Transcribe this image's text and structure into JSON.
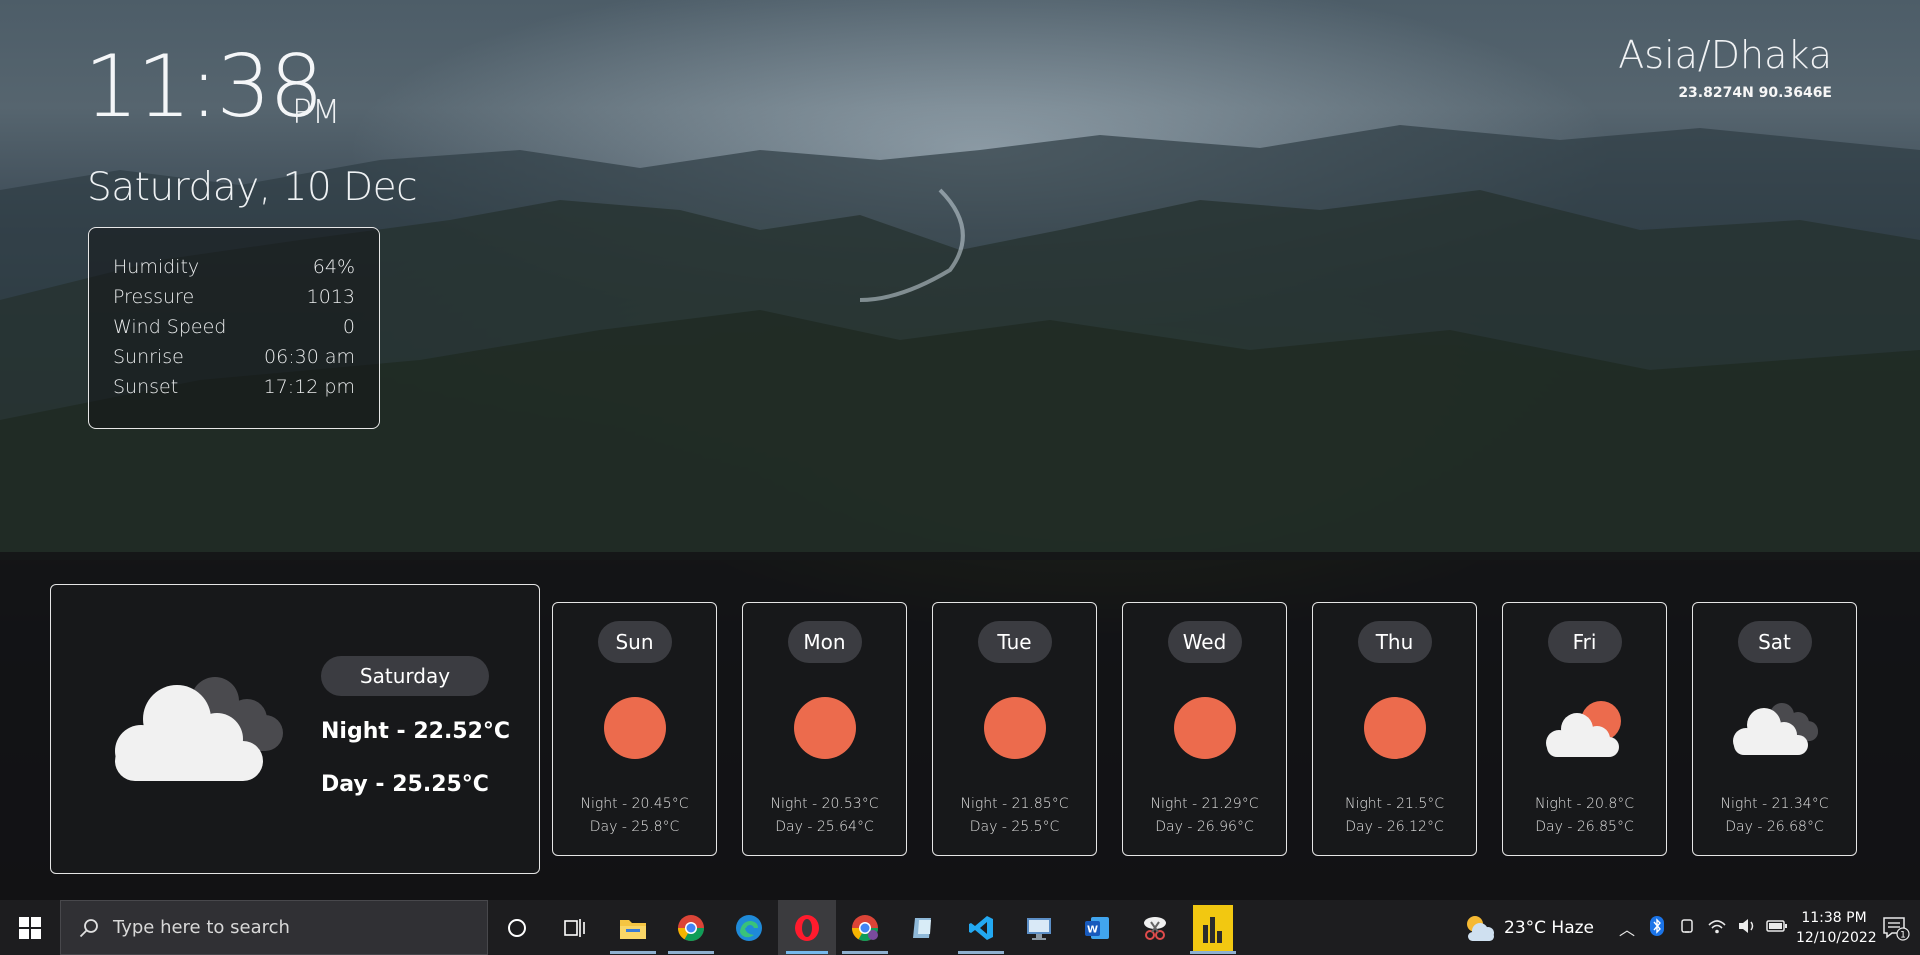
{
  "clock": {
    "time": "11:38",
    "ampm": "PM",
    "date": "Saturday, 10 Dec"
  },
  "location": {
    "timezone": "Asia/Dhaka",
    "coords": "23.8274N 90.3646E"
  },
  "details": [
    {
      "label": "Humidity",
      "value": "64%"
    },
    {
      "label": "Pressure",
      "value": "1013"
    },
    {
      "label": "Wind Speed",
      "value": "0"
    },
    {
      "label": "Sunrise",
      "value": "06:30 am"
    },
    {
      "label": "Sunset",
      "value": "17:12 pm"
    }
  ],
  "today": {
    "day": "Saturday",
    "night": "Night - 22.52°C",
    "dayTemp": "Day - 25.25°C",
    "icon": "cloudy-icon"
  },
  "forecast": [
    {
      "day": "Sun",
      "night": "Night - 20.45°C",
      "dayTemp": "Day - 25.8°C",
      "icon": "sun-icon"
    },
    {
      "day": "Mon",
      "night": "Night - 20.53°C",
      "dayTemp": "Day - 25.64°C",
      "icon": "sun-icon"
    },
    {
      "day": "Tue",
      "night": "Night - 21.85°C",
      "dayTemp": "Day - 25.5°C",
      "icon": "sun-icon"
    },
    {
      "day": "Wed",
      "night": "Night - 21.29°C",
      "dayTemp": "Day - 26.96°C",
      "icon": "sun-icon"
    },
    {
      "day": "Thu",
      "night": "Night - 21.5°C",
      "dayTemp": "Day - 26.12°C",
      "icon": "sun-icon"
    },
    {
      "day": "Fri",
      "night": "Night - 20.8°C",
      "dayTemp": "Day - 26.85°C",
      "icon": "partly-cloudy-icon"
    },
    {
      "day": "Sat",
      "night": "Night - 21.34°C",
      "dayTemp": "Day - 26.68°C",
      "icon": "cloudy-icon"
    }
  ],
  "taskbar": {
    "search_placeholder": "Type here to search",
    "weather": "23°C  Haze",
    "time": "11:38 PM",
    "date": "12/10/2022",
    "notifications": "1"
  },
  "colors": {
    "sun": "#ec6b4d",
    "pill": "#3b3c41",
    "taskbar": "#1d1d1f",
    "accent": "#76b9ed"
  }
}
